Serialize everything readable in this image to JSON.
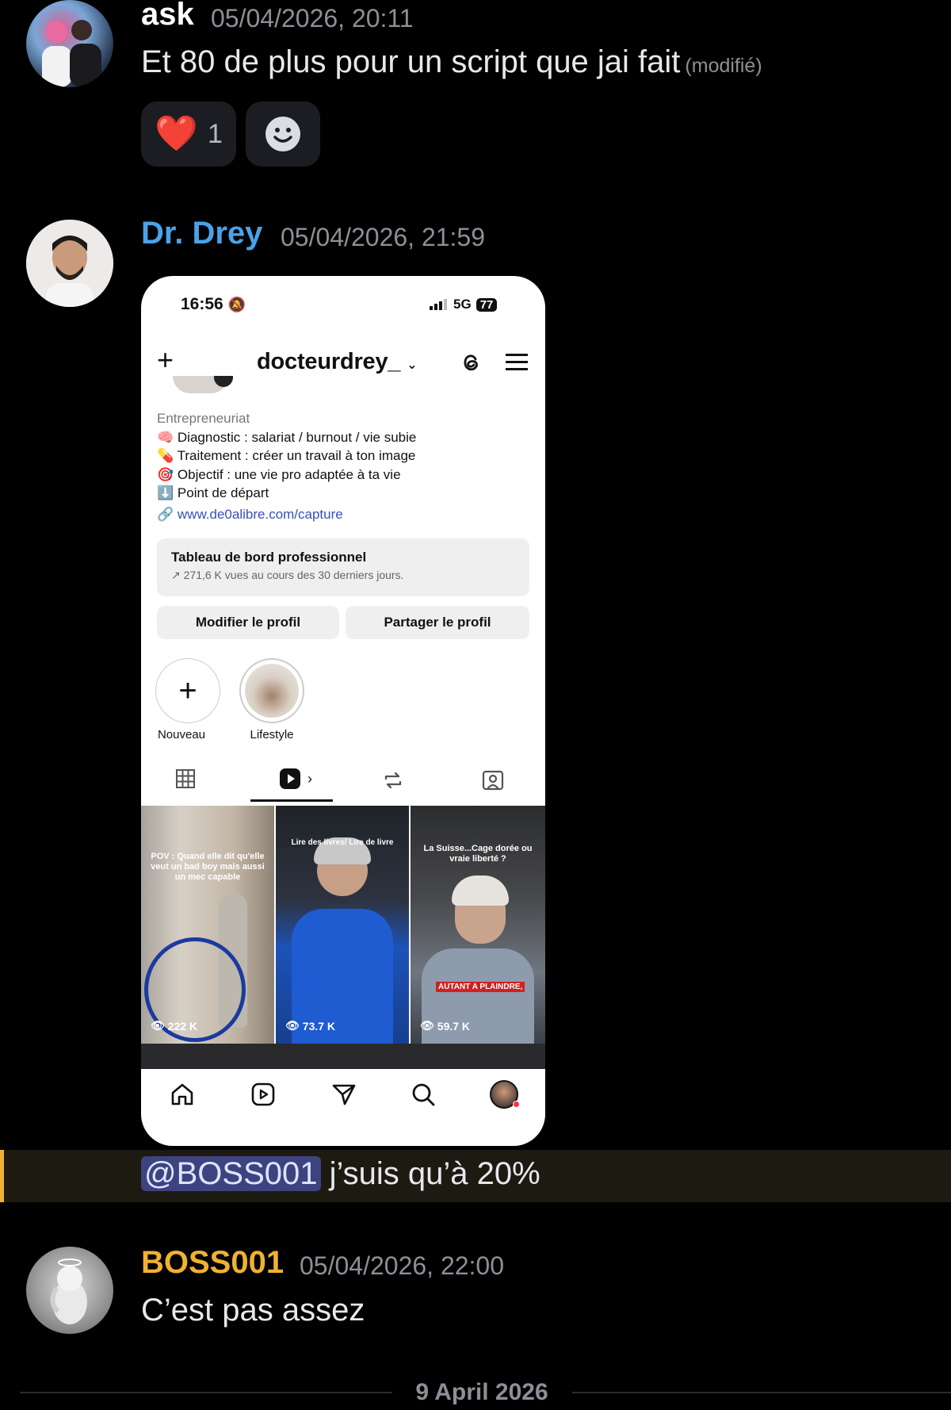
{
  "messages": [
    {
      "author": "ask",
      "timestamp": "05/04/2026, 20:11",
      "text": "Et 80 de plus pour un script que jai fait",
      "edited_label": "(modifié)",
      "reactions": [
        {
          "emoji": "❤️",
          "count": "1"
        }
      ],
      "author_color": "#ffffff"
    },
    {
      "author": "Dr. Drey",
      "timestamp": "05/04/2026, 21:59",
      "author_color": "#4aa2e8",
      "attachment": {
        "status_time": "16:56",
        "status_network": "5G",
        "battery": "77",
        "username": "docteurdrey_",
        "bio": {
          "category": "Entrepreneuriat",
          "lines": [
            {
              "icon": "🧠",
              "text": "Diagnostic : salariat / burnout / vie subie"
            },
            {
              "icon": "💊",
              "text": "Traitement : créer un travail à ton image"
            },
            {
              "icon": "🎯",
              "text": "Objectif : une vie pro adaptée à ta vie"
            },
            {
              "icon": "⬇️",
              "text": "Point de départ"
            }
          ],
          "link": "www.de0alibre.com/capture"
        },
        "dashboard": {
          "title": "Tableau de bord professionnel",
          "subtitle": "271,6 K vues au cours des 30 derniers jours."
        },
        "buttons": {
          "edit": "Modifier le profil",
          "share": "Partager le profil"
        },
        "highlights": [
          {
            "label": "Nouveau"
          },
          {
            "label": "Lifestyle"
          }
        ],
        "reels": [
          {
            "caption": "POV : Quand elle dit qu'elle veut un bad boy mais aussi un mec capable",
            "views": "222 K"
          },
          {
            "caption": "Lire des livres/ Lire de livre",
            "views": "73.7 K"
          },
          {
            "caption": "La Suisse...Cage dorée ou vraie liberté ?",
            "overlay": "AUTANT A PLAINDRE,",
            "views": "59.7 K"
          }
        ]
      },
      "follow_up": {
        "mention": "@BOSS001",
        "text": "j’suis qu’à 20%"
      }
    },
    {
      "author": "BOSS001",
      "timestamp": "05/04/2026, 22:00",
      "text": "C’est pas assez",
      "author_color": "#f0b132"
    }
  ],
  "date_divider": "9 April 2026",
  "colors": {
    "background": "#000000",
    "mention_bg": "#3c437f",
    "highlight_bar": "#f0b132",
    "timestamp": "#8e8f96"
  }
}
